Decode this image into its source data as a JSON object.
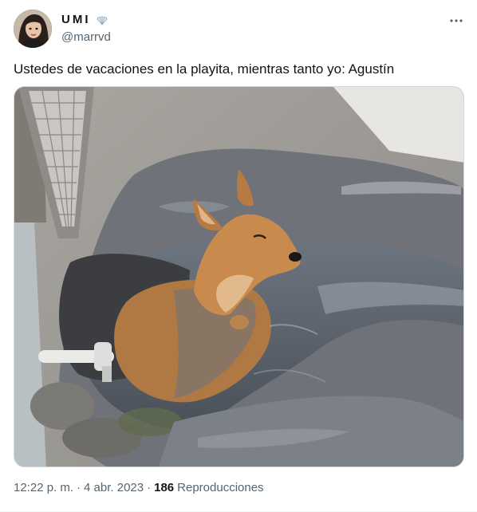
{
  "author": {
    "display_name": "UMI",
    "handle": "@marrvd",
    "avatar": "woman-portrait-avatar",
    "badge_icon": "shell-emoji-icon"
  },
  "tweet": {
    "text": "Ustedes de vacaciones en la playita, mientras tanto yo: Agustín",
    "image_description": "dog-sitting-in-puddle-photo"
  },
  "meta": {
    "time": "12:22 p. m.",
    "separator": "·",
    "date": "4 abr. 2023",
    "views_count": "186",
    "views_label": "Reproducciones"
  },
  "icons": {
    "more": "more-dots-icon"
  },
  "colors": {
    "secondary_text": "#536471",
    "primary_text": "#0f1419",
    "border": "#cfd9de"
  }
}
